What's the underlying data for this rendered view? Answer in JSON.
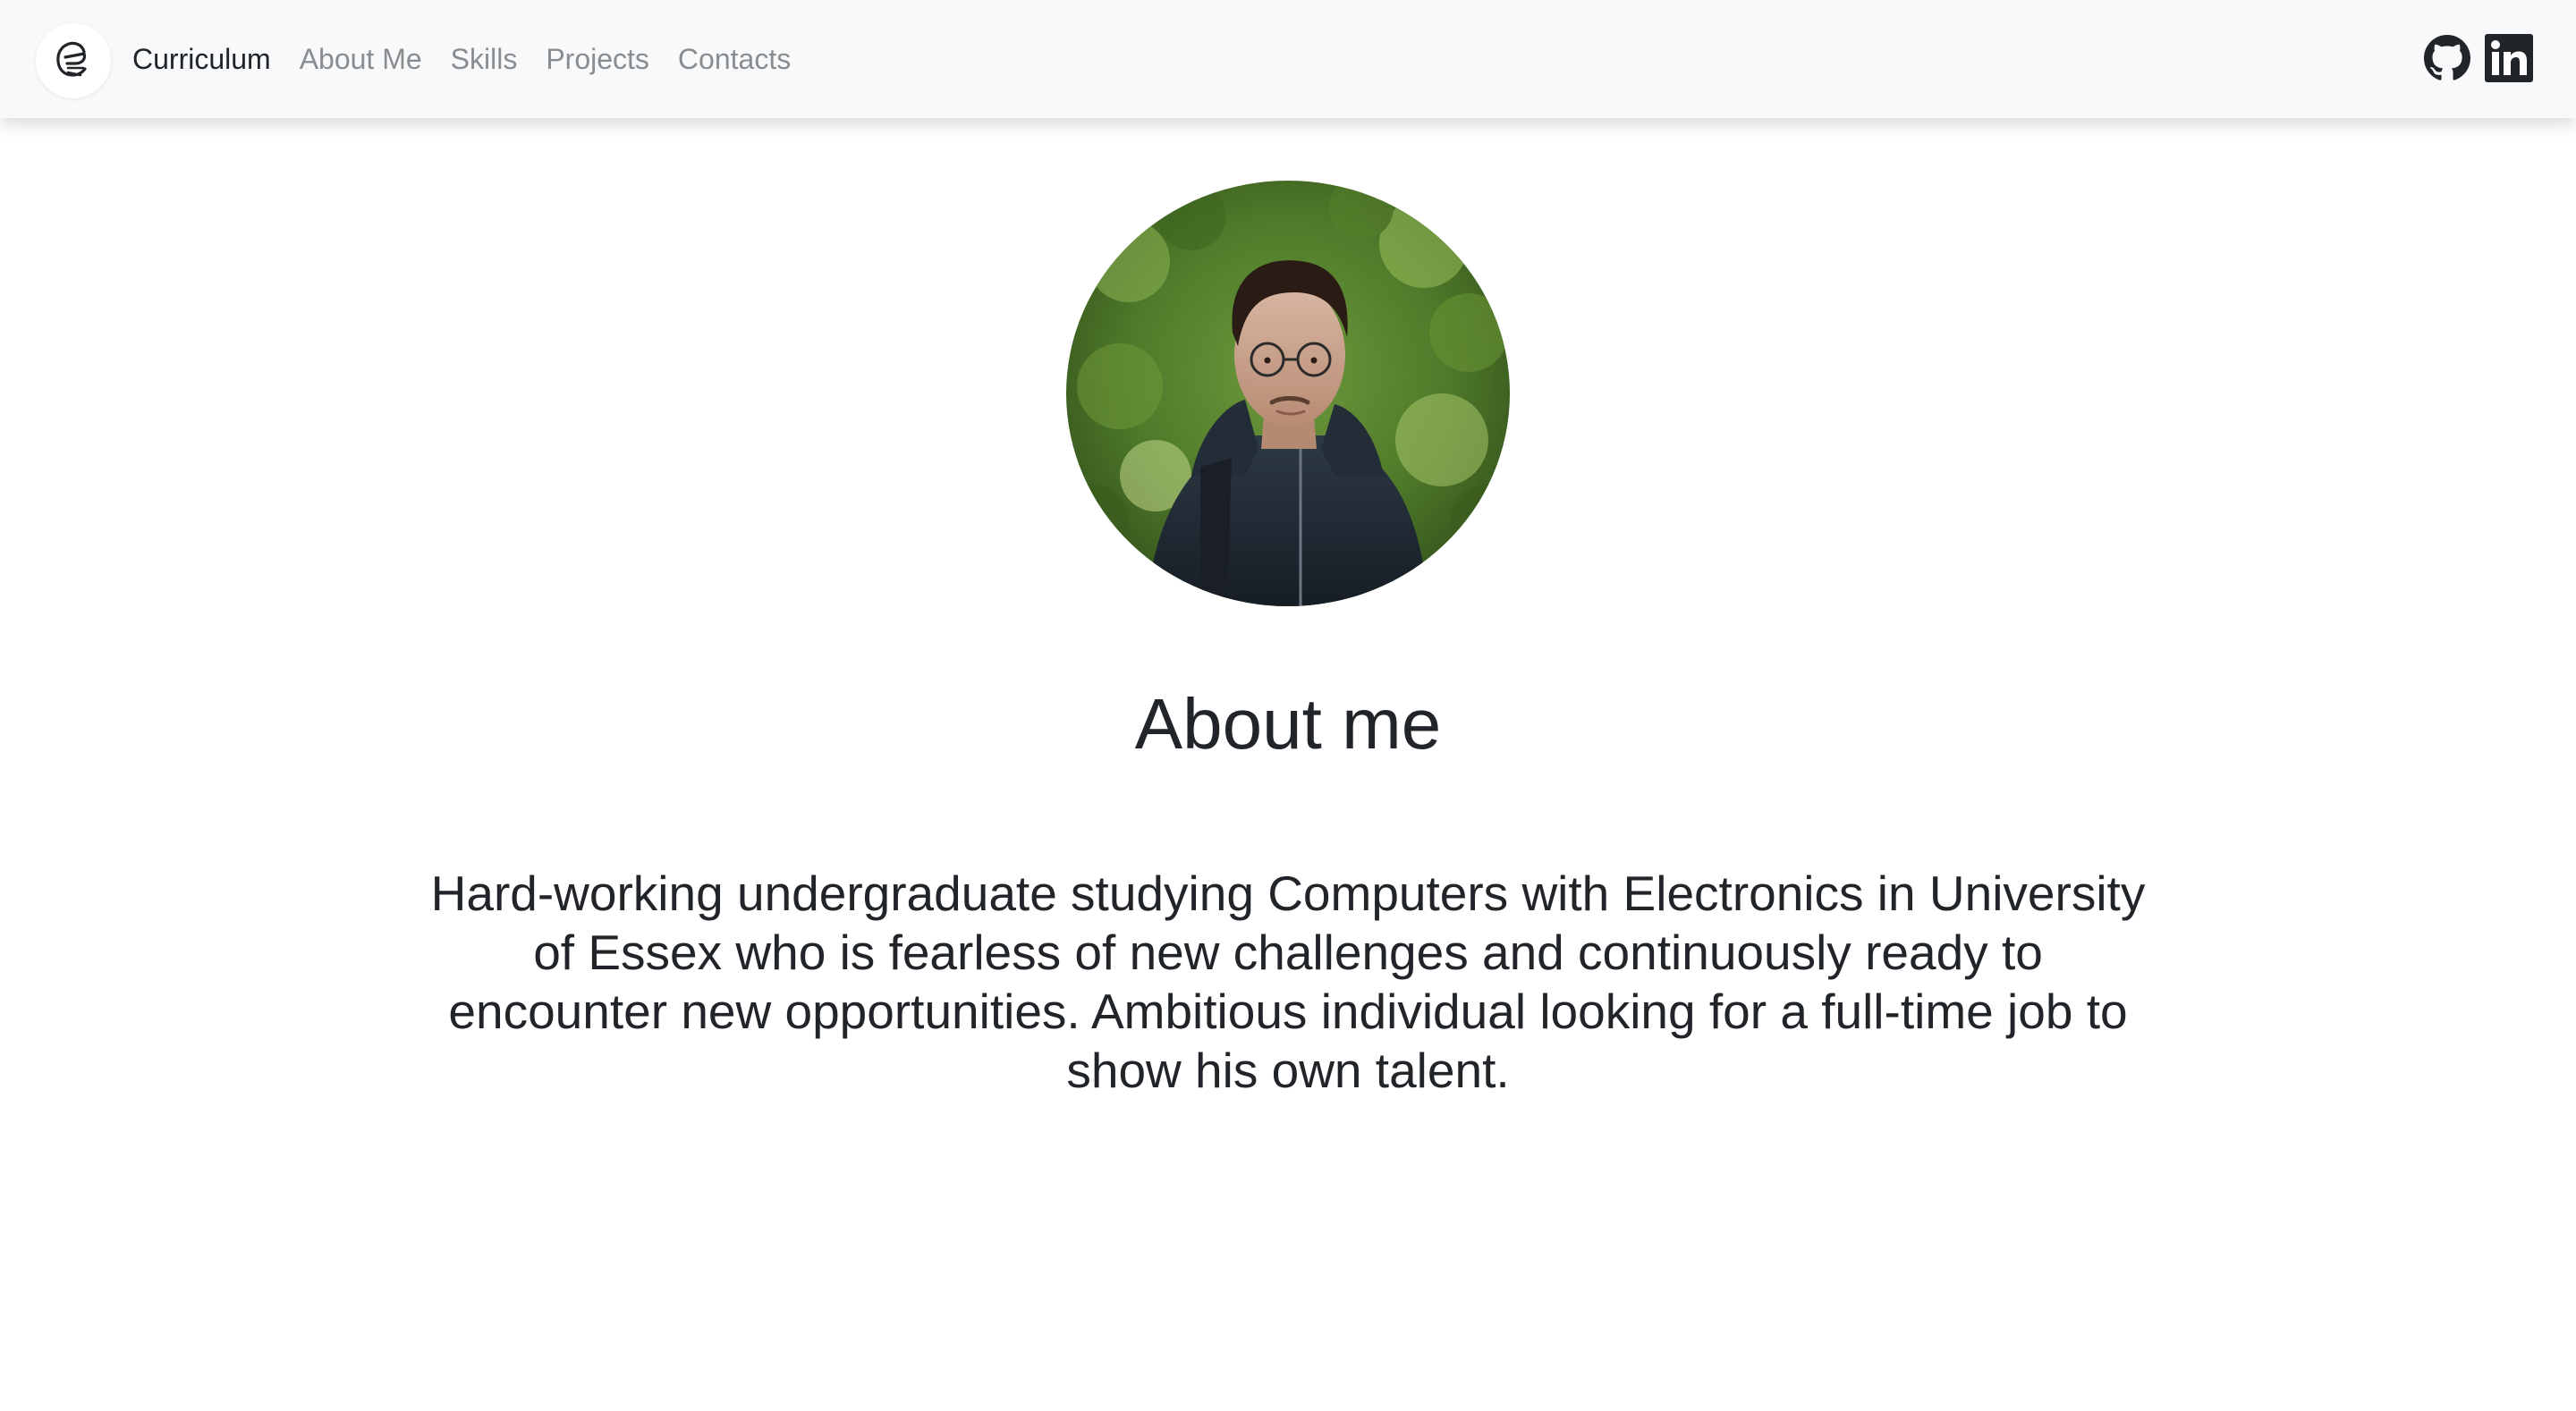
{
  "nav": {
    "items": [
      {
        "label": "Curriculum",
        "active": true
      },
      {
        "label": "About Me",
        "active": false
      },
      {
        "label": "Skills",
        "active": false
      },
      {
        "label": "Projects",
        "active": false
      },
      {
        "label": "Contacts",
        "active": false
      }
    ],
    "brand_icon": "e-logo-icon",
    "social": [
      "github-icon",
      "linkedin-icon"
    ]
  },
  "colors": {
    "navbar_bg": "#f8f9fa",
    "nav_active": "#212529",
    "nav_muted": "#8a8d90",
    "text": "#212529"
  },
  "main": {
    "title": "About me",
    "bio": "Hard-working undergraduate studying Computers with Electronics in University of Essex who is fearless of new challenges and continuously ready to encounter new opportunities. Ambitious individual looking for a full-time job to show his own talent."
  }
}
